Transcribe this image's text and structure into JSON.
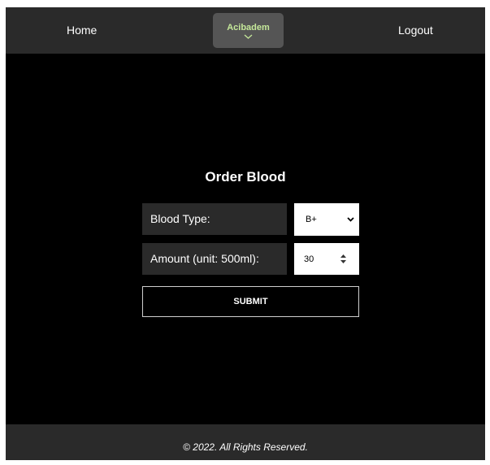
{
  "navbar": {
    "home_label": "Home",
    "brand_label": "Acibadem",
    "brand_icon": "chevron-down-icon",
    "logout_label": "Logout"
  },
  "form": {
    "title": "Order Blood",
    "blood_type_label": "Blood Type:",
    "blood_type_value": "B+",
    "amount_label": "Amount (unit: 500ml):",
    "amount_value": "30",
    "submit_label": "SUBMIT"
  },
  "footer": {
    "text": "© 2022. All Rights Reserved."
  },
  "colors": {
    "background": "#000000",
    "bar": "#2a2a2a",
    "brand_box": "#555555",
    "brand_text": "#c5e89a"
  }
}
